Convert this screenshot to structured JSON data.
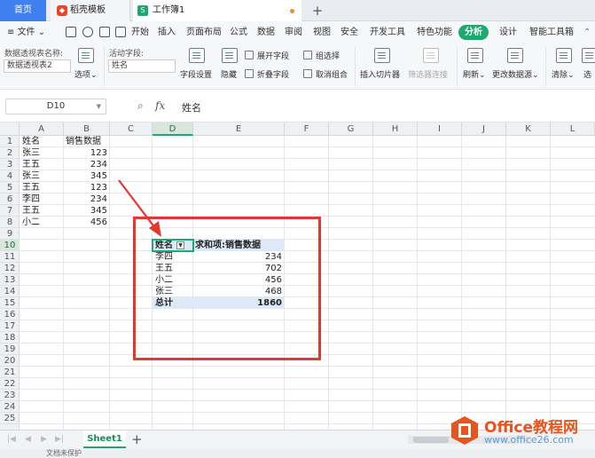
{
  "tabs": {
    "home": "首页",
    "template": "稻壳模板",
    "workbook": "工作簿1",
    "new_tab": "+"
  },
  "menu": {
    "file": "文件",
    "items": [
      "开始",
      "插入",
      "页面布局",
      "公式",
      "数据",
      "审阅",
      "视图",
      "安全",
      "开发工具",
      "特色功能",
      "分析",
      "设计",
      "智能工具箱"
    ],
    "active": "分析"
  },
  "ribbon": {
    "pivot_name_label": "数据透视表名称:",
    "pivot_name_value": "数据透视表2",
    "options": "选项",
    "active_field_label": "活动字段:",
    "active_field_value": "姓名",
    "field_settings": "字段设置",
    "hide": "隐藏",
    "expand_field": "展开字段",
    "collapse_field": "折叠字段",
    "group_selection": "组选择",
    "ungroup": "取消组合",
    "insert_slicer": "插入切片器",
    "filter_connections": "筛选器连接",
    "refresh": "刷新",
    "change_source": "更改数据源",
    "clear": "清除",
    "select": "选"
  },
  "formula_bar": {
    "name_box": "D10",
    "fx": "fx",
    "value": "姓名"
  },
  "columns": [
    "A",
    "B",
    "C",
    "D",
    "E",
    "F",
    "G",
    "H",
    "I",
    "J",
    "K",
    "L"
  ],
  "selected_column": "D",
  "rows": [
    "1",
    "2",
    "3",
    "4",
    "5",
    "6",
    "7",
    "8",
    "9",
    "10",
    "11",
    "12",
    "13",
    "14",
    "15",
    "16",
    "17",
    "18",
    "19",
    "20",
    "21",
    "22",
    "23",
    "24",
    "25"
  ],
  "selected_row": "10",
  "source_table": {
    "header_name": "姓名",
    "header_value": "销售数据",
    "rows": [
      {
        "name": "张三",
        "value": "123"
      },
      {
        "name": "王五",
        "value": "234"
      },
      {
        "name": "张三",
        "value": "345"
      },
      {
        "name": "王五",
        "value": "123"
      },
      {
        "name": "李四",
        "value": "234"
      },
      {
        "name": "王五",
        "value": "345"
      },
      {
        "name": "小二",
        "value": "456"
      }
    ]
  },
  "pivot_table": {
    "header_name": "姓名",
    "header_value": "求和项:销售数据",
    "rows": [
      {
        "name": "李四",
        "value": "234"
      },
      {
        "name": "王五",
        "value": "702"
      },
      {
        "name": "小二",
        "value": "456"
      },
      {
        "name": "张三",
        "value": "468"
      }
    ],
    "total_label": "总计",
    "total_value": "1860"
  },
  "sheet_tabs": [
    "Sheet1"
  ],
  "status": {
    "text": "文档未保护"
  },
  "watermark": {
    "name": "Office教程网",
    "url": "www.office26.com"
  },
  "colors": {
    "accent": "#1fa870",
    "highlight_box": "#e03a30",
    "pivot_fill": "#dde9f6",
    "home_tab": "#3f7ff0"
  }
}
